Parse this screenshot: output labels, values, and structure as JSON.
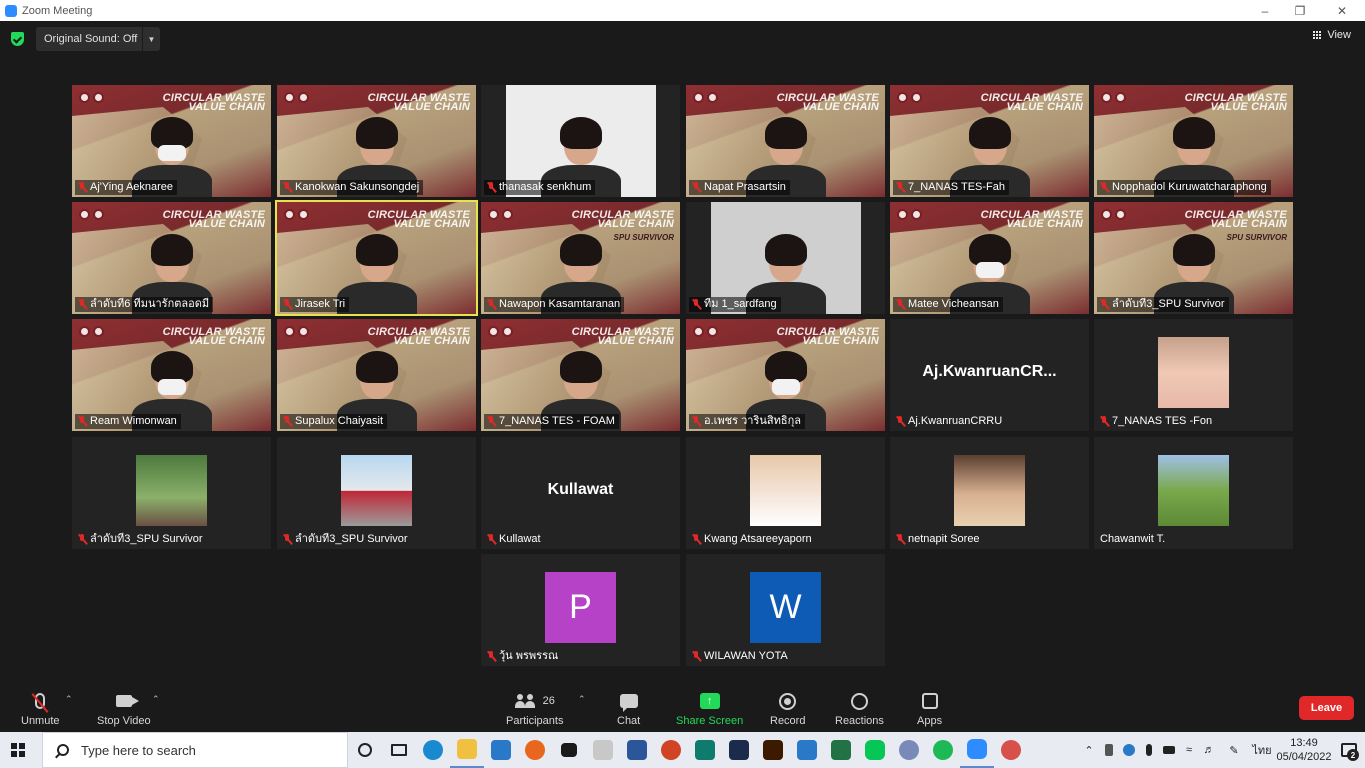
{
  "window": {
    "title": "Zoom Meeting"
  },
  "top": {
    "original_sound": "Original Sound: Off",
    "view": "View"
  },
  "banner": {
    "line1": "CIRCULAR WASTE",
    "line2": "VALUE CHAIN",
    "spu": "SPU SURVIVOR"
  },
  "participants": [
    {
      "name": "Aj'Ying Aeknaree",
      "kind": "bg",
      "mask": true
    },
    {
      "name": "Kanokwan Sakunsongdej",
      "kind": "bg"
    },
    {
      "name": "thanasak senkhum",
      "kind": "white"
    },
    {
      "name": "Napat Prasartsin",
      "kind": "bg"
    },
    {
      "name": "7_NANAS TES-Fah",
      "kind": "bg"
    },
    {
      "name": "Nopphadol Kuruwatcharaphong",
      "kind": "bg"
    },
    {
      "name": "ลำดับที่6 ทีมนารักตลอดมี",
      "kind": "bg"
    },
    {
      "name": "Jirasek Tri",
      "kind": "bg",
      "speaking": true
    },
    {
      "name": "Nawapon Kasamtaranan",
      "kind": "bg",
      "spu": true
    },
    {
      "name": "ทีม 1_sardfang",
      "kind": "gray"
    },
    {
      "name": "Matee Vicheansan",
      "kind": "bg",
      "mask": true
    },
    {
      "name": "ลำดับที่3_SPU Survivor",
      "kind": "bg",
      "spu": true
    },
    {
      "name": "Ream Wimonwan",
      "kind": "bg",
      "mask": true
    },
    {
      "name": "Supalux Chaiyasit",
      "kind": "bg"
    },
    {
      "name": "7_NANAS TES - FOAM",
      "kind": "bg"
    },
    {
      "name": "อ.เพชร วารินสิทธิกุล",
      "kind": "bg",
      "mask": true
    },
    {
      "name": "Aj.KwanruanCRRU",
      "kind": "text",
      "big": "Aj.KwanruanCR..."
    },
    {
      "name": "7_NANAS TES -Fon",
      "kind": "photo",
      "photo": "photo5"
    },
    {
      "name": "ลำดับที่3_SPU Survivor",
      "kind": "photo",
      "photo": "photo1"
    },
    {
      "name": "ลำดับที่3_SPU Survivor",
      "kind": "photo",
      "photo": "photo3"
    },
    {
      "name": "Kullawat",
      "kind": "text",
      "big": "Kullawat"
    },
    {
      "name": "Kwang Atsareeyaporn",
      "kind": "photo",
      "photo": "photo4"
    },
    {
      "name": "netnapit Soree",
      "kind": "photo",
      "photo": "photo2"
    },
    {
      "name": "Chawanwit T.",
      "kind": "photo",
      "photo": "photo6",
      "unmuted": true
    },
    {
      "name": "วุ้น พรพรรณ",
      "kind": "letter",
      "letter": "P",
      "color": "#b642c8"
    },
    {
      "name": "WILAWAN YOTA",
      "kind": "letter",
      "letter": "W",
      "color": "#0e5bb5"
    }
  ],
  "toolbar": {
    "unmute": "Unmute",
    "stop_video": "Stop Video",
    "participants": "Participants",
    "participant_count": "26",
    "chat": "Chat",
    "share_screen": "Share Screen",
    "record": "Record",
    "reactions": "Reactions",
    "apps": "Apps",
    "leave": "Leave"
  },
  "taskbar": {
    "search_placeholder": "Type here to search",
    "lang": "ไทย",
    "time": "13:49",
    "date": "05/04/2022",
    "notifications": "2"
  },
  "colors": {
    "leave": "#e02828",
    "share": "#23d959",
    "speaking": "#e6e34e"
  }
}
